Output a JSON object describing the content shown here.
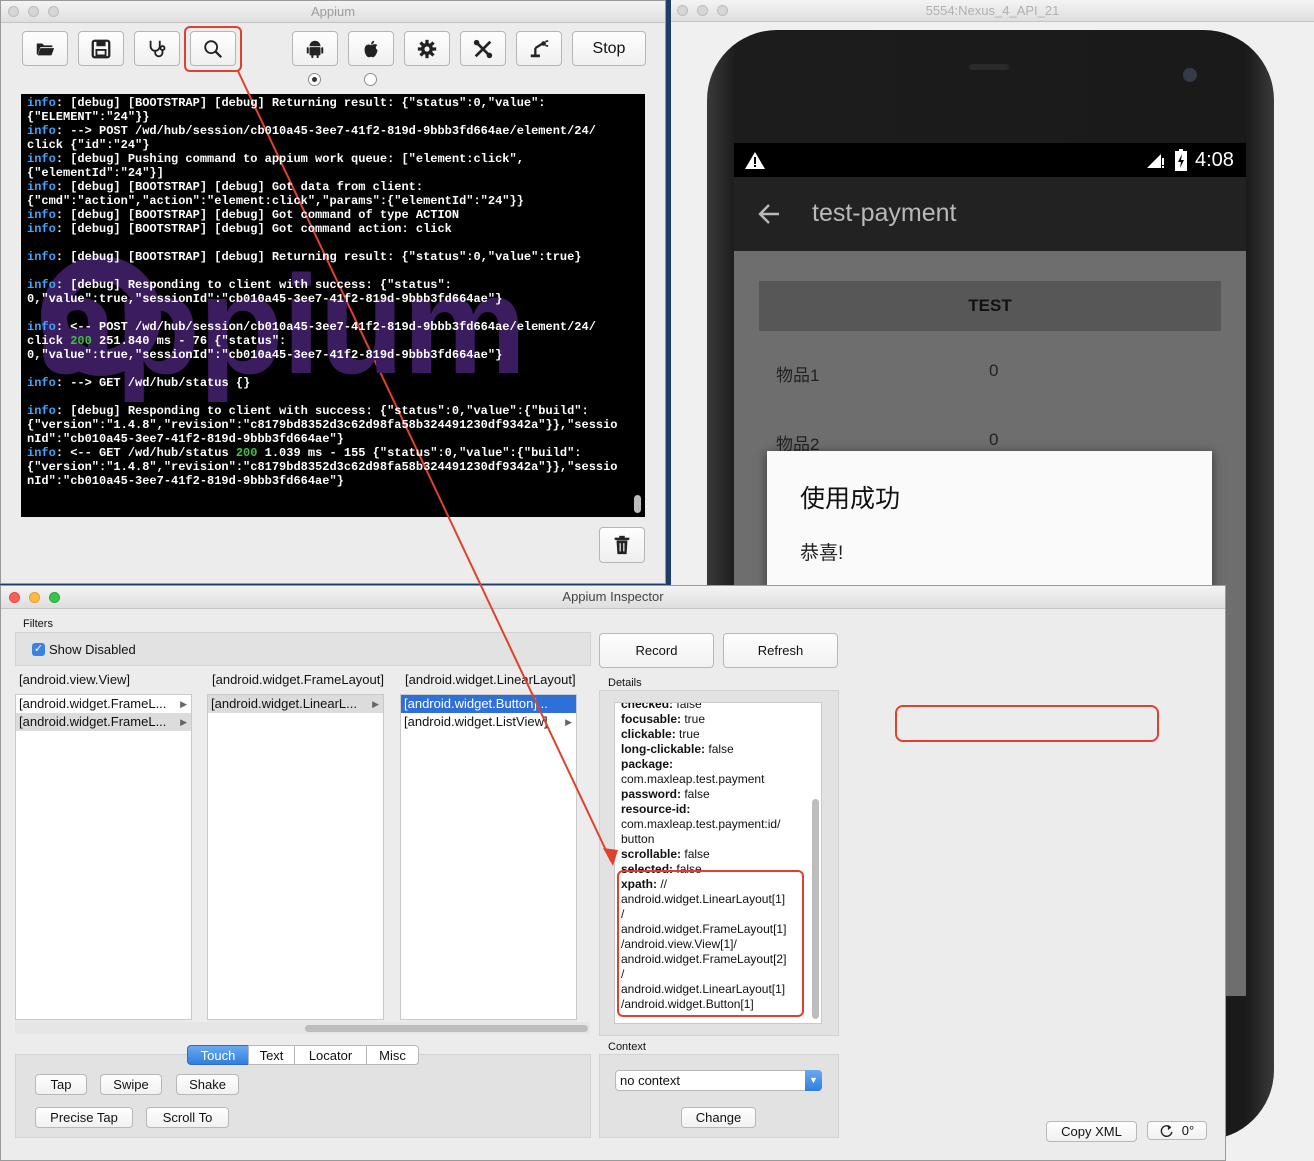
{
  "appium_window": {
    "title": "Appium",
    "toolbar": {
      "open_icon": "folder-open-icon",
      "save_icon": "floppy-disk-icon",
      "doctor_icon": "stethoscope-icon",
      "inspector_icon": "magnifier-icon",
      "android_icon": "android-icon",
      "apple_icon": "apple-icon",
      "settings_icon": "gear-icon",
      "developer_icon": "wrench-icon",
      "robot_icon": "robot-arm-icon",
      "stop_label": "Stop"
    },
    "log_lines": [
      [
        "info",
        ": [debug] [BOOTSTRAP] [debug] Returning result: {\"status\":0,\"value\":"
      ],
      [
        "",
        "{\"ELEMENT\":\"24\"}}"
      ],
      [
        "info",
        ": --> POST /wd/hub/session/cb010a45-3ee7-41f2-819d-9bbb3fd664ae/element/24/"
      ],
      [
        "",
        "click {\"id\":\"24\"}"
      ],
      [
        "info",
        ": [debug] Pushing command to appium work queue: [\"element:click\","
      ],
      [
        "",
        "{\"elementId\":\"24\"}]"
      ],
      [
        "info",
        ": [debug] [BOOTSTRAP] [debug] Got data from client:"
      ],
      [
        "",
        "{\"cmd\":\"action\",\"action\":\"element:click\",\"params\":{\"elementId\":\"24\"}}"
      ],
      [
        "info",
        ": [debug] [BOOTSTRAP] [debug] Got command of type ACTION"
      ],
      [
        "info",
        ": [debug] [BOOTSTRAP] [debug] Got command action: click"
      ],
      [
        "",
        ""
      ],
      [
        "info",
        ": [debug] [BOOTSTRAP] [debug] Returning result: {\"status\":0,\"value\":true}"
      ],
      [
        "",
        ""
      ],
      [
        "info",
        ": [debug] Responding to client with success: {\"status\":"
      ],
      [
        "",
        "0,\"value\":true,\"sessionId\":\"cb010a45-3ee7-41f2-819d-9bbb3fd664ae\"}"
      ],
      [
        "",
        ""
      ],
      [
        "info",
        ": <-- POST /wd/hub/session/cb010a45-3ee7-41f2-819d-9bbb3fd664ae/element/24/"
      ],
      [
        "code",
        "click |200| 251.840 ms - 76 {\"status\":"
      ],
      [
        "",
        "0,\"value\":true,\"sessionId\":\"cb010a45-3ee7-41f2-819d-9bbb3fd664ae\"}"
      ],
      [
        "",
        ""
      ],
      [
        "info",
        ": --> GET /wd/hub/status {}"
      ],
      [
        "",
        ""
      ],
      [
        "info",
        ": [debug] Responding to client with success: {\"status\":0,\"value\":{\"build\":"
      ],
      [
        "",
        "{\"version\":\"1.4.8\",\"revision\":\"c8179bd8352d3c62d98fa58b324491230df9342a\"}},\"sessio"
      ],
      [
        "",
        "nId\":\"cb010a45-3ee7-41f2-819d-9bbb3fd664ae\"}"
      ],
      [
        "infocode",
        ": <-- GET /wd/hub/status |200| 1.039 ms - 155 {\"status\":0,\"value\":{\"build\":"
      ],
      [
        "",
        "{\"version\":\"1.4.8\",\"revision\":\"c8179bd8352d3c62d98fa58b324491230df9342a\"}},\"sessio"
      ],
      [
        "",
        "nId\":\"cb010a45-3ee7-41f2-819d-9bbb3fd664ae\"}"
      ]
    ],
    "watermark": "appium",
    "trash_icon": "trash-icon"
  },
  "emulator": {
    "title": "5554:Nexus_4_API_21",
    "status_time": "4:08",
    "app_title": "test-payment",
    "test_button": "TEST",
    "items": [
      {
        "name": "物品1",
        "value": "0"
      },
      {
        "name": "物品2",
        "value": "0"
      }
    ],
    "dialog_title": "使用成功",
    "dialog_message": "恭喜!"
  },
  "inspector": {
    "title": "Appium Inspector",
    "filters_label": "Filters",
    "show_disabled_label": "Show Disabled",
    "columns": [
      {
        "header": "[android.view.View]",
        "items": [
          "[android.widget.FrameL...",
          "[android.widget.FrameL..."
        ]
      },
      {
        "header": "[android.widget.FrameLayout]",
        "items": [
          "[android.widget.LinearL..."
        ]
      },
      {
        "header": "[android.widget.LinearLayout]",
        "items": [
          "[android.widget.Button]...",
          "[android.widget.ListView]"
        ]
      }
    ],
    "record_label": "Record",
    "refresh_label": "Refresh",
    "details_label": "Details",
    "details": [
      {
        "k": "checked:",
        "v": " false"
      },
      {
        "k": "focusable:",
        "v": " true"
      },
      {
        "k": "clickable:",
        "v": " true"
      },
      {
        "k": "long-clickable:",
        "v": " false"
      },
      {
        "k": "package:",
        "v": ""
      },
      {
        "k": "",
        "v": "com.maxleap.test.payment"
      },
      {
        "k": "password:",
        "v": " false"
      },
      {
        "k": "resource-id:",
        "v": ""
      },
      {
        "k": "",
        "v": "com.maxleap.test.payment:id/"
      },
      {
        "k": "",
        "v": "button"
      },
      {
        "k": "scrollable:",
        "v": " false"
      },
      {
        "k": "selected:",
        "v": " false"
      },
      {
        "k": "xpath:",
        "v": " //"
      },
      {
        "k": "",
        "v": "android.widget.LinearLayout[1]"
      },
      {
        "k": "",
        "v": "/"
      },
      {
        "k": "",
        "v": "android.widget.FrameLayout[1]"
      },
      {
        "k": "",
        "v": "/android.view.View[1]/"
      },
      {
        "k": "",
        "v": "android.widget.FrameLayout[2]"
      },
      {
        "k": "",
        "v": "/"
      },
      {
        "k": "",
        "v": "android.widget.LinearLayout[1]"
      },
      {
        "k": "",
        "v": "/android.widget.Button[1]"
      }
    ],
    "tabs": [
      "Touch",
      "Text",
      "Locator",
      "Misc"
    ],
    "touch_buttons": [
      "Tap",
      "Swipe",
      "Shake",
      "Precise Tap",
      "Scroll To"
    ],
    "context_label": "Context",
    "context_value": "no context",
    "change_label": "Change",
    "copy_xml_label": "Copy XML",
    "rotation_label": "0°"
  },
  "colors": {
    "highlight_red": "#e0412d",
    "log_info": "#3aa6ff",
    "log_status_code": "#3fc33f",
    "selection_blue": "#2f6fd8"
  }
}
